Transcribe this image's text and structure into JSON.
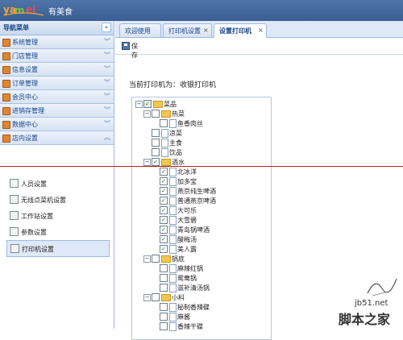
{
  "app": {
    "title": "有美食"
  },
  "sidebar": {
    "title": "导航菜单",
    "collapse_icon": "double-chevron-left-icon",
    "menus": [
      {
        "label": "系统管理",
        "icon": "folder-icon",
        "chevron": "double-chevron-down"
      },
      {
        "label": "门店管理",
        "icon": "folder-icon",
        "chevron": "double-chevron-down"
      },
      {
        "label": "信息设置",
        "icon": "folder-icon",
        "chevron": "double-chevron-down"
      },
      {
        "label": "订单管理",
        "icon": "folder-icon",
        "chevron": "double-chevron-down"
      },
      {
        "label": "会员中心",
        "icon": "folder-icon",
        "chevron": "double-chevron-down"
      },
      {
        "label": "进销存管理",
        "icon": "folder-icon",
        "chevron": "double-chevron-down"
      },
      {
        "label": "数据中心",
        "icon": "folder-icon",
        "chevron": "double-chevron-down"
      },
      {
        "label": "店内设置",
        "icon": "folder-icon",
        "chevron": "double-chevron-up"
      }
    ],
    "sub_items": [
      {
        "label": "人员设置",
        "icon": "person-icon"
      },
      {
        "label": "无线点菜机设置",
        "icon": "device-icon"
      },
      {
        "label": "工作站设置",
        "icon": "device-icon"
      },
      {
        "label": "参数设置",
        "icon": "device-icon"
      },
      {
        "label": "打印机设置",
        "icon": "printer-icon",
        "active": true
      }
    ]
  },
  "tabs": [
    {
      "label": "欢迎使用",
      "closable": false
    },
    {
      "label": "打印机设置",
      "closable": true
    },
    {
      "label": "设置打印机",
      "closable": true,
      "active": true
    }
  ],
  "toolbar": {
    "save_label": "保存"
  },
  "content": {
    "printer_label": "当前打印机为：",
    "printer_name": "收银打印机"
  },
  "tree": [
    {
      "label": "菜品",
      "level": 0,
      "type": "folder",
      "checked": "partial",
      "expanded": true
    },
    {
      "label": "热菜",
      "level": 1,
      "type": "folder",
      "checked": false,
      "expanded": true
    },
    {
      "label": "鱼香肉丝",
      "level": 2,
      "type": "leaf",
      "checked": false
    },
    {
      "label": "凉菜",
      "level": 1,
      "type": "leaf",
      "checked": false
    },
    {
      "label": "主食",
      "level": 1,
      "type": "leaf",
      "checked": false
    },
    {
      "label": "饮品",
      "level": 1,
      "type": "leaf",
      "checked": false
    },
    {
      "label": "酒水",
      "level": 1,
      "type": "folder",
      "checked": true,
      "expanded": true
    },
    {
      "label": "北冰洋",
      "level": 2,
      "type": "leaf",
      "checked": true
    },
    {
      "label": "加多宝",
      "level": 2,
      "type": "leaf",
      "checked": true
    },
    {
      "label": "燕京纯生啤酒",
      "level": 2,
      "type": "leaf",
      "checked": true
    },
    {
      "label": "普通燕京啤酒",
      "level": 2,
      "type": "leaf",
      "checked": true
    },
    {
      "label": "大可乐",
      "level": 2,
      "type": "leaf",
      "checked": true
    },
    {
      "label": "大雪碧",
      "level": 2,
      "type": "leaf",
      "checked": true
    },
    {
      "label": "青岛锅啤酒",
      "level": 2,
      "type": "leaf",
      "checked": true
    },
    {
      "label": "酸梅汤",
      "level": 2,
      "type": "leaf",
      "checked": true
    },
    {
      "label": "美人露",
      "level": 2,
      "type": "leaf",
      "checked": true
    },
    {
      "label": "锅底",
      "level": 1,
      "type": "folder",
      "checked": false,
      "expanded": true
    },
    {
      "label": "麻辣红锅",
      "level": 2,
      "type": "leaf",
      "checked": false
    },
    {
      "label": "鸳鸯锅",
      "level": 2,
      "type": "leaf",
      "checked": false
    },
    {
      "label": "滋补清汤锅",
      "level": 2,
      "type": "leaf",
      "checked": false
    },
    {
      "label": "小料",
      "level": 1,
      "type": "folder",
      "checked": false,
      "expanded": true
    },
    {
      "label": "秘制香辣碟",
      "level": 2,
      "type": "leaf",
      "checked": false
    },
    {
      "label": "麻酱",
      "level": 2,
      "type": "leaf",
      "checked": false
    },
    {
      "label": "香辣干碟",
      "level": 2,
      "type": "leaf",
      "checked": false
    }
  ],
  "watermark": {
    "site": "jb51.net",
    "name": "脚本之家"
  },
  "colors": {
    "header": "#3a5e92",
    "accent": "#15428b",
    "menu_icon": "#e0862e",
    "folder": "#f3c74d"
  }
}
